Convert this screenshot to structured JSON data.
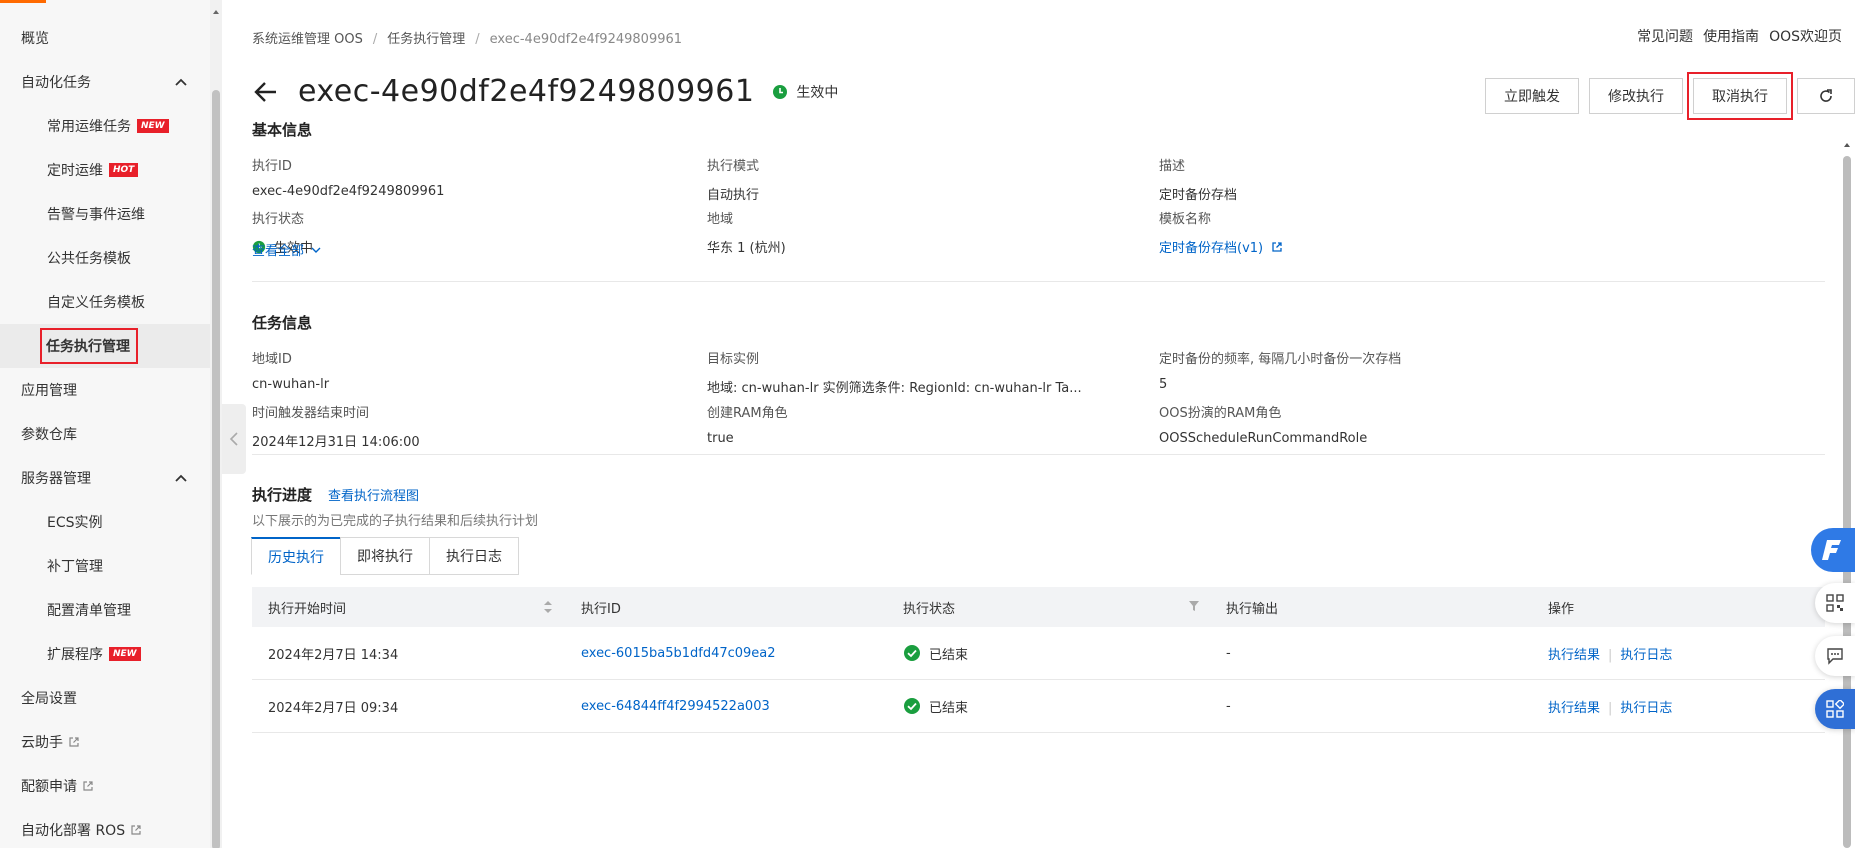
{
  "sidebar": {
    "items": [
      {
        "label": "概览",
        "level": 1
      },
      {
        "label": "自动化任务",
        "level": 1,
        "expanded": true
      },
      {
        "label": "常用运维任务",
        "level": 2,
        "badge": "NEW"
      },
      {
        "label": "定时运维",
        "level": 2,
        "badge": "HOT"
      },
      {
        "label": "告警与事件运维",
        "level": 2
      },
      {
        "label": "公共任务模板",
        "level": 2
      },
      {
        "label": "自定义任务模板",
        "level": 2
      },
      {
        "label": "任务执行管理",
        "level": 2,
        "active": true
      },
      {
        "label": "应用管理",
        "level": 1
      },
      {
        "label": "参数仓库",
        "level": 1
      },
      {
        "label": "服务器管理",
        "level": 1,
        "expanded": true
      },
      {
        "label": "ECS实例",
        "level": 2
      },
      {
        "label": "补丁管理",
        "level": 2
      },
      {
        "label": "配置清单管理",
        "level": 2
      },
      {
        "label": "扩展程序",
        "level": 2,
        "badge": "NEW"
      },
      {
        "label": "全局设置",
        "level": 1
      },
      {
        "label": "云助手",
        "level": 1,
        "external": true
      },
      {
        "label": "配额申请",
        "level": 1,
        "external": true
      },
      {
        "label": "自动化部署 ROS",
        "level": 1,
        "external": true
      }
    ]
  },
  "breadcrumb": [
    "系统运维管理 OOS",
    "任务执行管理",
    "exec-4e90df2e4f9249809961"
  ],
  "toplinks": [
    "常见问题",
    "使用指南",
    "OOS欢迎页"
  ],
  "header": {
    "title": "exec-4e90df2e4f9249809961",
    "status": "生效中",
    "buttons": {
      "trigger": "立即触发",
      "modify": "修改执行",
      "cancel": "取消执行"
    }
  },
  "basic_info": {
    "title": "基本信息",
    "fields": {
      "exec_id": {
        "label": "执行ID",
        "value": "exec-4e90df2e4f9249809961"
      },
      "exec_mode": {
        "label": "执行模式",
        "value": "自动执行"
      },
      "desc": {
        "label": "描述",
        "value": "定时备份存档"
      },
      "exec_state": {
        "label": "执行状态",
        "value": "生效中"
      },
      "region": {
        "label": "地域",
        "value": "华东 1 (杭州)"
      },
      "template": {
        "label": "模板名称",
        "value": "定时备份存档(v1)"
      }
    },
    "view_all": "查看全部"
  },
  "task_info": {
    "title": "任务信息",
    "fields": {
      "region_id": {
        "label": "地域ID",
        "value": "cn-wuhan-lr"
      },
      "target": {
        "label": "目标实例",
        "value": "地域: cn-wuhan-lr 实例筛选条件: RegionId: cn-wuhan-lr Ta..."
      },
      "freq": {
        "label": "定时备份的频率, 每隔几小时备份一次存档",
        "value": "5"
      },
      "end_time": {
        "label": "时间触发器结束时间",
        "value": "2024年12月31日 14:06:00"
      },
      "ram_create": {
        "label": "创建RAM角色",
        "value": "true"
      },
      "ram_role": {
        "label": "OOS扮演的RAM角色",
        "value": "OOSScheduleRunCommandRole"
      }
    }
  },
  "progress": {
    "title": "执行进度",
    "flow_link": "查看执行流程图",
    "desc": "以下展示的为已完成的子执行结果和后续执行计划",
    "tabs": [
      "历史执行",
      "即将执行",
      "执行日志"
    ]
  },
  "table": {
    "headers": [
      "执行开始时间",
      "执行ID",
      "执行状态",
      "执行输出",
      "操作"
    ],
    "rows": [
      {
        "start": "2024年2月7日 14:34",
        "id": "exec-6015ba5b1dfd47c09ea2",
        "state": "已结束",
        "output": "-",
        "op1": "执行结果",
        "op2": "执行日志"
      },
      {
        "start": "2024年2月7日 09:34",
        "id": "exec-64844ff4f2994522a003",
        "state": "已结束",
        "output": "-",
        "op1": "执行结果",
        "op2": "执行日志"
      }
    ]
  },
  "colors": {
    "link": "#0064c8",
    "success": "#1a9e3f",
    "highlight": "#e8202a",
    "accent": "#ff6a00"
  }
}
